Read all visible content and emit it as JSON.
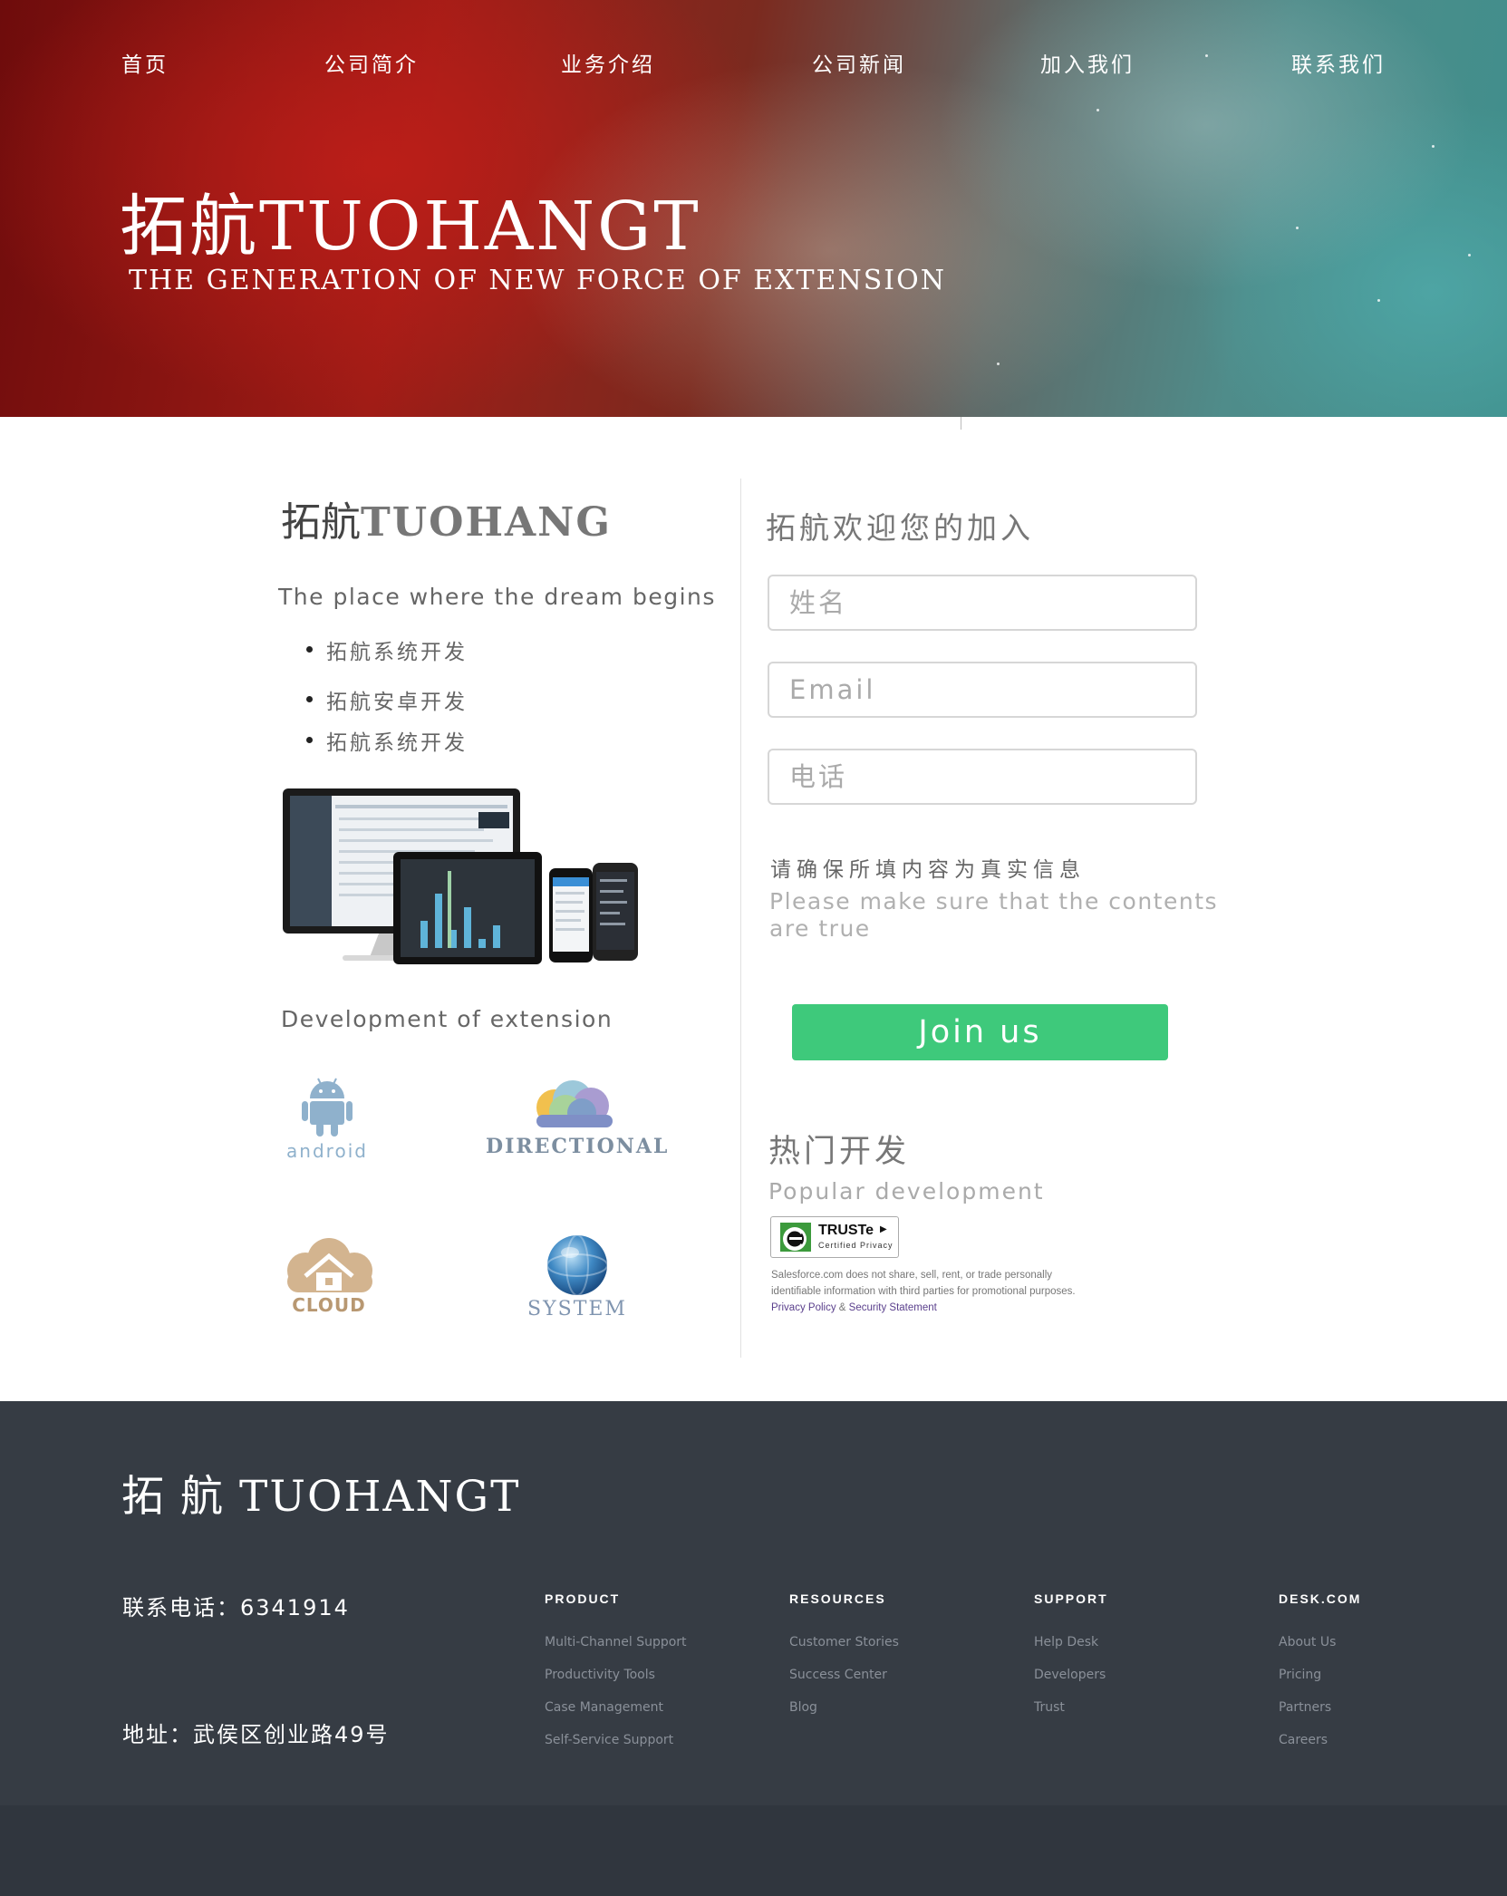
{
  "nav": {
    "items": [
      "首页",
      "公司简介",
      "业务介绍",
      "公司新闻",
      "加入我们",
      "联系我们"
    ]
  },
  "hero": {
    "title": "拓航TUOHANGT",
    "subtitle": "THE GENERATION OF NEW FORCE OF EXTENSION"
  },
  "intro": {
    "brand_cn": "拓航",
    "brand_latin": "TUOHANG",
    "tagline": "The place where the dream begins",
    "bullets": [
      "拓航系统开发",
      "拓航安卓开发",
      "拓航系统开发"
    ],
    "dev_title": "Development of extension",
    "logos": [
      {
        "label": "android",
        "icon": "android-icon"
      },
      {
        "label": "DIRECTIONAL",
        "icon": "rainbow-cloud-icon"
      },
      {
        "label": "CLOUD",
        "icon": "house-cloud-icon"
      },
      {
        "label": "SYSTEM",
        "icon": "globe-icon"
      }
    ]
  },
  "join": {
    "title": "拓航欢迎您的加入",
    "name_placeholder": "姓名",
    "email_placeholder": "Email",
    "phone_placeholder": "电话",
    "note_cn": "请确保所填内容为真实信息",
    "note_en": "Please make sure that the contents are  true",
    "button": "Join us",
    "hot_cn": "热门开发",
    "hot_en": "Popular development",
    "truste_brand": "TRUSTe",
    "truste_sub": "Certified Privacy",
    "privacy_text": "Salesforce.com does not share, sell, rent, or trade personally identifiable information with third parties for promotional purposes.",
    "privacy_link": "Privacy Policy",
    "privacy_amp": "&",
    "security_link": "Security Statement"
  },
  "footer": {
    "brand_cn": "拓航",
    "brand_latin": "TUOHANGT",
    "phone": "联系电话：6341914",
    "address": "地址：武侯区创业路49号",
    "columns": [
      {
        "title": "PRODUCT",
        "links": [
          "Multi-Channel Support",
          "Productivity Tools",
          "Case Management",
          "Self-Service Support"
        ]
      },
      {
        "title": "RESOURCES",
        "links": [
          "Customer Stories",
          "Success Center",
          "Blog"
        ]
      },
      {
        "title": "SUPPORT",
        "links": [
          "Help Desk",
          "Developers",
          "Trust"
        ]
      },
      {
        "title": "DESK.COM",
        "links": [
          "About Us",
          "Pricing",
          "Partners",
          "Careers"
        ]
      }
    ]
  },
  "colors": {
    "accent_green": "#3ec97b",
    "footer_bg": "#363c44",
    "link_purple": "#5a3f8c"
  }
}
